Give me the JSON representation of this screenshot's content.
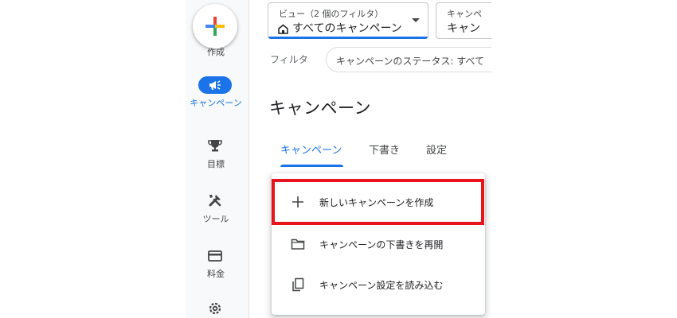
{
  "nav": {
    "create_label": "作成",
    "items": [
      {
        "label": "キャンペーン",
        "icon": "megaphone-icon",
        "active": true
      },
      {
        "label": "目標",
        "icon": "trophy-icon",
        "active": false
      },
      {
        "label": "ツール",
        "icon": "tools-icon",
        "active": false
      },
      {
        "label": "料金",
        "icon": "credit-card-icon",
        "active": false
      },
      {
        "label": "",
        "icon": "gear-icon",
        "active": false
      }
    ]
  },
  "view_selector": {
    "caption": "ビュー（2 個のフィルタ）",
    "value": "すべてのキャンペーン"
  },
  "campaign_selector": {
    "caption": "キャンペ",
    "value": "キャン"
  },
  "filter": {
    "label": "フィルタ",
    "chip": "キャンペーンのステータス: すべて"
  },
  "page_title": "キャンペーン",
  "tabs": [
    {
      "label": "キャンペーン",
      "active": true
    },
    {
      "label": "下書き",
      "active": false
    },
    {
      "label": "設定",
      "active": false
    }
  ],
  "menu": {
    "items": [
      {
        "label": "新しいキャンペーンを作成",
        "icon": "plus-icon"
      },
      {
        "label": "キャンペーンの下書きを再開",
        "icon": "folder-icon"
      },
      {
        "label": "キャンペーン設定を読み込む",
        "icon": "copy-icon"
      }
    ]
  },
  "colors": {
    "accent": "#1a73e8",
    "highlight": "#e8141b"
  }
}
